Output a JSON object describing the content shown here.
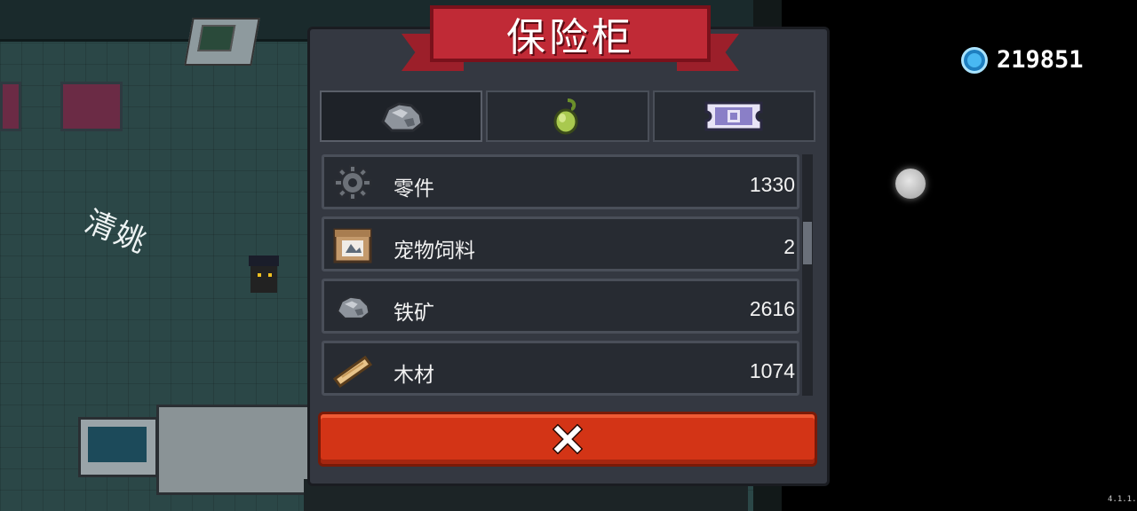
{
  "vault": {
    "title": "保险柜",
    "tabs": [
      {
        "icon": "iron-ore-icon",
        "active": true
      },
      {
        "icon": "seed-icon",
        "active": false
      },
      {
        "icon": "ticket-icon",
        "active": false
      }
    ],
    "items": [
      {
        "name": "零件",
        "count": "1330",
        "icon": "gear-icon"
      },
      {
        "name": "宠物饲料",
        "count": "2",
        "icon": "pet-food-bag-icon"
      },
      {
        "name": "铁矿",
        "count": "2616",
        "icon": "iron-ore-icon"
      },
      {
        "name": "木材",
        "count": "1074",
        "icon": "wood-plank-icon"
      }
    ],
    "close_icon": "close-icon"
  },
  "currency": {
    "icon": "gem-icon",
    "value": "219851",
    "color": "#49b8f2"
  },
  "scene": {
    "watermark": "清姚"
  },
  "version": "4.1.1.",
  "colors": {
    "panel": "#343841",
    "banner": "#c02a36",
    "close_button": "#d33416"
  }
}
